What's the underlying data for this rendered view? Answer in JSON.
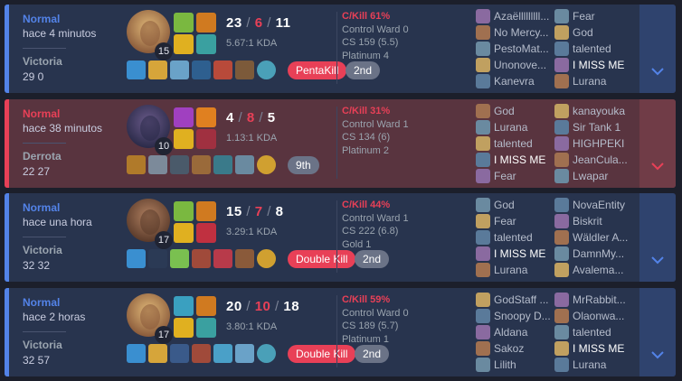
{
  "colors": {
    "win_accent": "#5383e8",
    "loss_accent": "#e84057"
  },
  "matches": [
    {
      "mode": "Normal",
      "ago": "hace 4 minutos",
      "result": "Victoria",
      "duration": "29 0",
      "level": "15",
      "k": "23",
      "d": "6",
      "a": "11",
      "kda": "5.67:1 KDA",
      "multikill": "PentaKill",
      "place": "2nd",
      "ck": "C/Kill 61%",
      "ward": "Control Ward 0",
      "cs": "CS 159 (5.5)",
      "rank": "Platinum 4",
      "team1": [
        "Azaëlllllllll...",
        "No Mercy...",
        "PestoMat...",
        "Unonove...",
        "Kanevra"
      ],
      "team2": [
        "Fear",
        "God",
        "talented",
        "I MISS ME",
        "Lurana"
      ],
      "me_team": 2,
      "me_idx": 3,
      "expand_icon": "chevron-down-icon"
    },
    {
      "mode": "Normal",
      "ago": "hace 38 minutos",
      "result": "Derrota",
      "duration": "22 27",
      "level": "10",
      "k": "4",
      "d": "8",
      "a": "5",
      "kda": "1.13:1 KDA",
      "multikill": "",
      "place": "9th",
      "ck": "C/Kill 31%",
      "ward": "Control Ward 1",
      "cs": "CS 134 (6)",
      "rank": "Platinum 2",
      "team1": [
        "God",
        "Lurana",
        "talented",
        "I MISS ME",
        "Fear"
      ],
      "team2": [
        "kanayouka",
        "Sir Tank 1",
        "HIGHPEKI",
        "JeanCula...",
        "Lwapar"
      ],
      "me_team": 1,
      "me_idx": 3,
      "expand_icon": "chevron-down-icon"
    },
    {
      "mode": "Normal",
      "ago": "hace una hora",
      "result": "Victoria",
      "duration": "32 32",
      "level": "17",
      "k": "15",
      "d": "7",
      "a": "8",
      "kda": "3.29:1 KDA",
      "multikill": "Double Kill",
      "place": "2nd",
      "ck": "C/Kill 44%",
      "ward": "Control Ward 1",
      "cs": "CS 222 (6.8)",
      "rank": "Gold 1",
      "team1": [
        "God",
        "Fear",
        "talented",
        "I MISS ME",
        "Lurana"
      ],
      "team2": [
        "NovaEntity",
        "Biskrit",
        "Wäldler A...",
        "DamnMy...",
        "Avalema..."
      ],
      "me_team": 1,
      "me_idx": 3,
      "expand_icon": "chevron-down-icon"
    },
    {
      "mode": "Normal",
      "ago": "hace 2 horas",
      "result": "Victoria",
      "duration": "32 57",
      "level": "17",
      "k": "20",
      "d": "10",
      "a": "18",
      "kda": "3.80:1 KDA",
      "multikill": "Double Kill",
      "place": "2nd",
      "ck": "C/Kill 59%",
      "ward": "Control Ward 0",
      "cs": "CS 189 (5.7)",
      "rank": "Platinum 1",
      "team1": [
        "GodStaff ...",
        "Snoopy D...",
        "Aldana",
        "Sakoz",
        "Lilith"
      ],
      "team2": [
        "MrRabbit...",
        "Olaonwa...",
        "talented",
        "I MISS ME",
        "Lurana"
      ],
      "me_team": 2,
      "me_idx": 3,
      "expand_icon": "chevron-down-icon"
    }
  ]
}
